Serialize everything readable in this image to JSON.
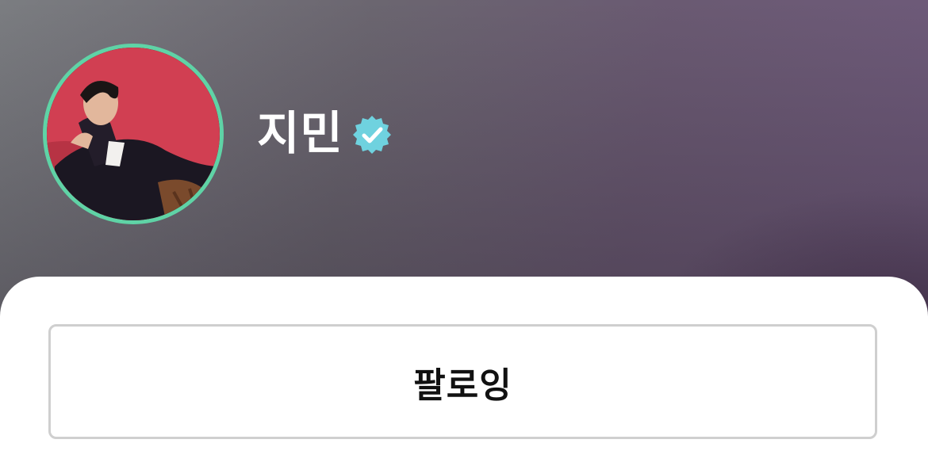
{
  "profile": {
    "name": "지민",
    "verified": true,
    "verified_icon": "verified-badge-icon",
    "avatar_ring_color": "#5fd3a6",
    "verified_color": "#6fd2df"
  },
  "actions": {
    "follow_label": "팔로잉"
  },
  "colors": {
    "header_gradient_start": "#7b7d81",
    "header_gradient_end": "#6e5a7a",
    "sheet_background": "#ffffff",
    "button_border": "#cfcfcf"
  }
}
